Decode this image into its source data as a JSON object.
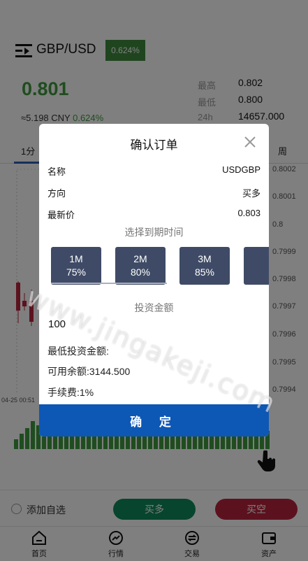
{
  "header": {
    "pair": "GBP/USD",
    "change_badge": "0.624%"
  },
  "price": {
    "last": "0.801",
    "cny_prefix": "≈5.198 CNY ",
    "cny_change": "0.624%"
  },
  "stats": [
    {
      "label": "最高",
      "value": "0.802"
    },
    {
      "label": "最低",
      "value": "0.800"
    },
    {
      "label": "24h",
      "value": "14657.000"
    }
  ],
  "chart_tabs": {
    "first": "1分",
    "last": "周"
  },
  "y_ticks": [
    "0.8002",
    "0.8001",
    "0.8",
    "0.7999",
    "0.7998",
    "0.7997",
    "0.7996",
    "0.7995",
    "0.7994"
  ],
  "date_tick": "04-25 00:51",
  "bottom_actions": {
    "favorite": "添加自选",
    "buy": "买多",
    "sell": "买空"
  },
  "tabbar": [
    {
      "label": "首页",
      "icon": "home-icon"
    },
    {
      "label": "行情",
      "icon": "market-icon"
    },
    {
      "label": "交易",
      "icon": "trade-icon"
    },
    {
      "label": "资产",
      "icon": "wallet-icon"
    }
  ],
  "modal": {
    "title": "确认订单",
    "rows": [
      {
        "label": "名称",
        "value": "USDGBP"
      },
      {
        "label": "方向",
        "value": "买多"
      },
      {
        "label": "最新价",
        "value": "0.803"
      }
    ],
    "expiry_label": "选择到期时间",
    "periods": [
      {
        "time": "1M",
        "rate": "75%"
      },
      {
        "time": "2M",
        "rate": "80%"
      },
      {
        "time": "3M",
        "rate": "85%"
      },
      {
        "time": "",
        "rate": ""
      }
    ],
    "amount_label": "投资金额",
    "amount_value": "100",
    "min_invest": "最低投资金额:",
    "balance": "可用余额:3144.500",
    "fee": "手续费:1%",
    "confirm": "确 定"
  },
  "watermark": "www.jingakeji.com",
  "colors": {
    "accent": "#0d57b5",
    "up": "#3f9a3f",
    "down": "#b8243d",
    "period_bg": "#3f4b66"
  }
}
